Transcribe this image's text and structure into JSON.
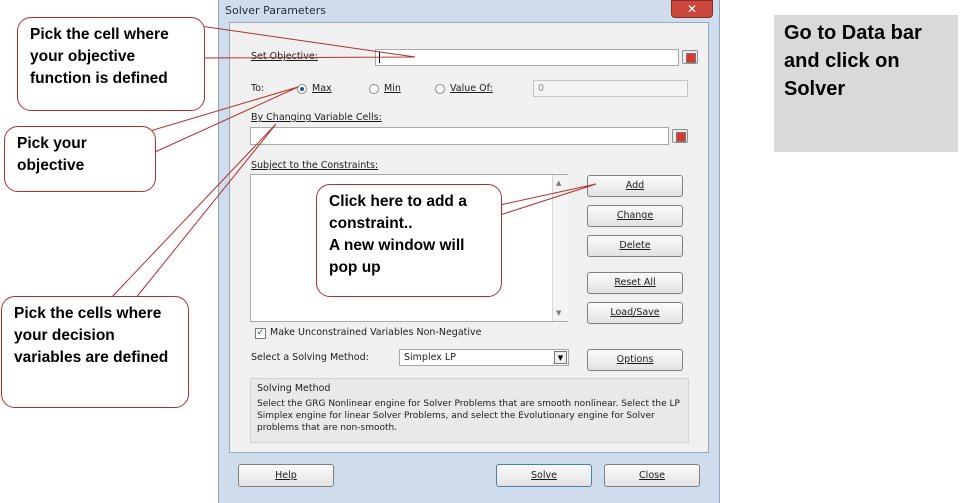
{
  "dialog": {
    "title": "Solver Parameters",
    "close_glyph": "✕",
    "set_objective_label": "Set Objective:",
    "to_label": "To:",
    "radio_max": "Max",
    "radio_min": "Min",
    "radio_value_of": "Value Of:",
    "value_of_field": "0",
    "changing_cells_label": "By Changing Variable Cells:",
    "constraints_label": "Subject to the Constraints:",
    "btn_add": "Add",
    "btn_change": "Change",
    "btn_delete": "Delete",
    "btn_reset_all": "Reset All",
    "btn_load_save": "Load/Save",
    "nonneg_checkbox": "Make Unconstrained Variables Non-Negative",
    "solving_method_label": "Select a Solving Method:",
    "solving_method_value": "Simplex LP",
    "btn_options": "Options",
    "method_group_title": "Solving Method",
    "method_description": "Select the GRG Nonlinear engine for Solver Problems that are smooth nonlinear. Select the LP Simplex engine for linear Solver Problems, and select the Evolutionary engine for Solver problems that are non-smooth.",
    "btn_help": "Help",
    "btn_solve": "Solve",
    "btn_close": "Close"
  },
  "callouts": {
    "objective": "Pick the cell where your objective function is defined",
    "pick_objective": "Pick your objective",
    "decision_variables": "Pick the cells where your decision variables are defined",
    "add_constraint_line1": "Click here to add a constraint..",
    "add_constraint_line2": "A new window will pop up"
  },
  "side_note": "Go to Data bar and click on Solver",
  "colors": {
    "callout_border": "#b0302a",
    "dialog_frame": "#cfdcec",
    "close_button": "#c9473b"
  }
}
